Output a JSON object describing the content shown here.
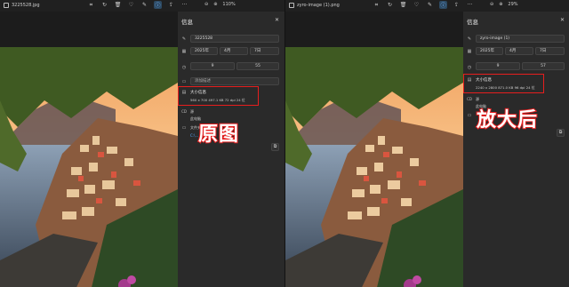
{
  "left": {
    "filename": "3225528.jpg",
    "zoom": "110%",
    "panel": {
      "title": "信息",
      "name_value": "3225528",
      "date_value": "2025年",
      "month_value": "4月",
      "day_value": "7日",
      "hour_value": "9",
      "minute_value": "55",
      "caption_placeholder": "添加描述",
      "size_title": "大小信息",
      "size_meta": "560 x 700   497.1 KB   72 dpi   24 位",
      "source_label": "源",
      "source_value": "此电脑",
      "folder_label": "文件夹",
      "folder_link": "C:\\..."
    },
    "overlay_text": "原图"
  },
  "right": {
    "filename": "zyro-image (1).png",
    "zoom": "29%",
    "panel": {
      "title": "信息",
      "name_value": "zyro-image (1)",
      "date_value": "2025年",
      "month_value": "4月",
      "day_value": "7日",
      "hour_value": "9",
      "minute_value": "57",
      "size_title": "大小信息",
      "size_meta": "2240 x 2800   871.0 KB   96 dpi   24 位",
      "source_label": "源",
      "source_value": "此电脑"
    },
    "overlay_text": "放大后"
  },
  "icons": [
    "file-icon",
    "crop-icon",
    "rotate-icon",
    "trash-icon",
    "heart-icon",
    "edit-icon",
    "info-icon",
    "share-icon",
    "more-icon",
    "zoom-out-icon",
    "zoom-in-icon",
    "close-icon"
  ]
}
